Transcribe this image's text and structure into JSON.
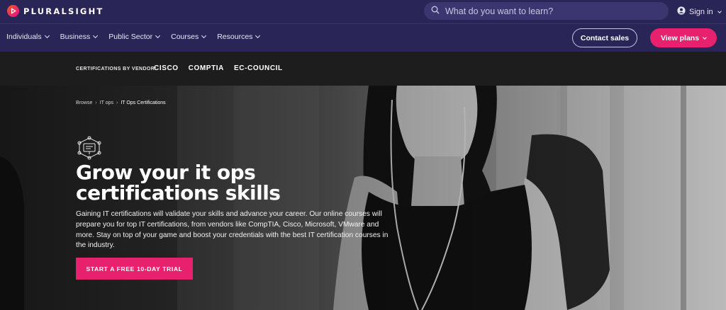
{
  "header": {
    "brand": "PLURALSIGHT",
    "search_placeholder": "What do you want to learn?",
    "signin_label": "Sign in"
  },
  "nav": {
    "items": [
      {
        "label": "Individuals"
      },
      {
        "label": "Business"
      },
      {
        "label": "Public Sector"
      },
      {
        "label": "Courses"
      },
      {
        "label": "Resources"
      }
    ],
    "contact_label": "Contact sales",
    "plans_label": "View plans"
  },
  "vendor_bar": {
    "label": "CERTIFICATIONS BY VENDOR:",
    "vendors": [
      "CISCO",
      "COMPTIA",
      "EC-COUNCIL"
    ]
  },
  "hero": {
    "breadcrumb": [
      "Browse",
      "IT ops",
      "IT Ops Certifications"
    ],
    "title_line1": "Grow your it ops",
    "title_line2": "certifications skills",
    "body": "Gaining IT certifications will validate your skills and advance your career. Our online courses will prepare you for top IT certifications, from vendors like CompTIA, Cisco, Microsoft, VMware and more. Stay on top of your game and boost your credentials with the best IT certification courses in the industry.",
    "cta_label": "START A FREE 10-DAY TRIAL"
  },
  "colors": {
    "header_bg": "#2a2557",
    "accent": "#e8216f",
    "vendor_bar_bg": "#1d1d1d"
  },
  "icons": [
    "pluralsight-logo-icon",
    "search-icon",
    "user-icon",
    "chevron-down-icon",
    "certification-icon"
  ]
}
